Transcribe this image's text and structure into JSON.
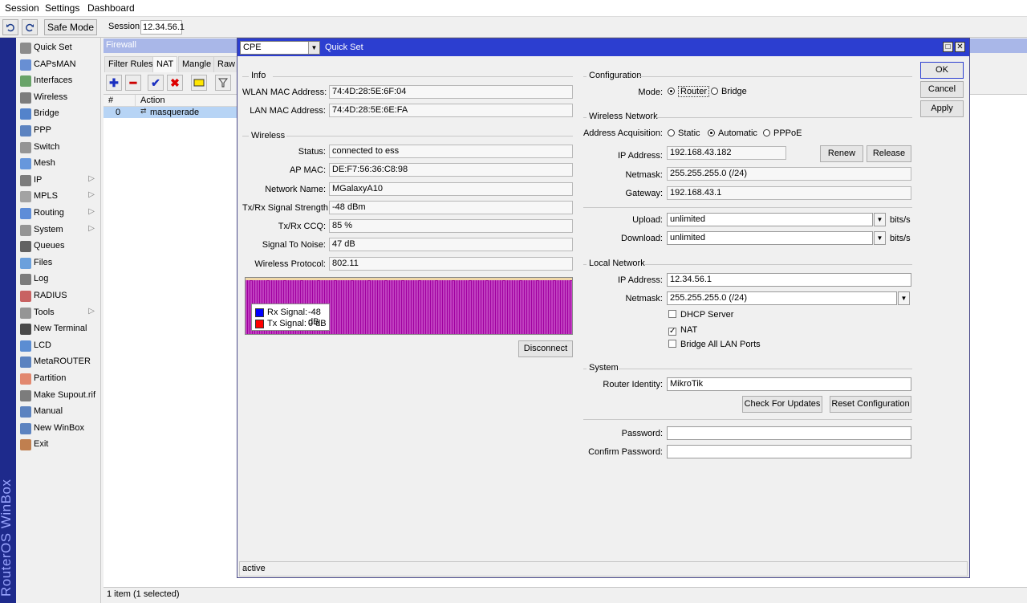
{
  "menubar": {
    "items": [
      "Session",
      "Settings",
      "Dashboard"
    ]
  },
  "toolbar": {
    "undo_icon": "undo-icon",
    "redo_icon": "redo-icon",
    "safe_mode": "Safe Mode",
    "session_label": "Session:",
    "session_value": "12.34.56.1"
  },
  "side_strip": {
    "text": "RouterOS WinBox"
  },
  "sidebar": {
    "items": [
      {
        "label": "Quick Set",
        "icon": "wand-icon",
        "arrow": ""
      },
      {
        "label": "CAPsMAN",
        "icon": "capsman-icon",
        "arrow": ""
      },
      {
        "label": "Interfaces",
        "icon": "interfaces-icon",
        "arrow": ""
      },
      {
        "label": "Wireless",
        "icon": "wireless-icon",
        "arrow": ""
      },
      {
        "label": "Bridge",
        "icon": "bridge-icon",
        "arrow": ""
      },
      {
        "label": "PPP",
        "icon": "ppp-icon",
        "arrow": ""
      },
      {
        "label": "Switch",
        "icon": "switch-icon",
        "arrow": ""
      },
      {
        "label": "Mesh",
        "icon": "mesh-icon",
        "arrow": ""
      },
      {
        "label": "IP",
        "icon": "ip-icon",
        "arrow": "▷"
      },
      {
        "label": "MPLS",
        "icon": "mpls-icon",
        "arrow": "▷"
      },
      {
        "label": "Routing",
        "icon": "routing-icon",
        "arrow": "▷"
      },
      {
        "label": "System",
        "icon": "gear-icon",
        "arrow": "▷"
      },
      {
        "label": "Queues",
        "icon": "queues-icon",
        "arrow": ""
      },
      {
        "label": "Files",
        "icon": "folder-icon",
        "arrow": ""
      },
      {
        "label": "Log",
        "icon": "log-icon",
        "arrow": ""
      },
      {
        "label": "RADIUS",
        "icon": "radius-icon",
        "arrow": ""
      },
      {
        "label": "Tools",
        "icon": "tools-icon",
        "arrow": "▷"
      },
      {
        "label": "New Terminal",
        "icon": "terminal-icon",
        "arrow": ""
      },
      {
        "label": "LCD",
        "icon": "lcd-icon",
        "arrow": ""
      },
      {
        "label": "MetaROUTER",
        "icon": "metarouter-icon",
        "arrow": ""
      },
      {
        "label": "Partition",
        "icon": "pie-icon",
        "arrow": ""
      },
      {
        "label": "Make Supout.rif",
        "icon": "supout-icon",
        "arrow": ""
      },
      {
        "label": "Manual",
        "icon": "help-icon",
        "arrow": ""
      },
      {
        "label": "New WinBox",
        "icon": "globe-icon",
        "arrow": ""
      },
      {
        "label": "Exit",
        "icon": "exit-icon",
        "arrow": ""
      }
    ]
  },
  "firewall": {
    "title": "Firewall",
    "tabs": [
      "Filter Rules",
      "NAT",
      "Mangle",
      "Raw"
    ],
    "selected_tab": "NAT",
    "tool_buttons": [
      "add-icon",
      "remove-icon",
      "enable-icon",
      "disable-icon",
      "comment-icon",
      "filter-icon"
    ],
    "columns": [
      "#",
      "Action"
    ],
    "rows": [
      {
        "num": "0",
        "action": "masquerade",
        "action_icon": "masquerade-icon"
      }
    ],
    "status": "1 item (1 selected)"
  },
  "quickset": {
    "mode_combo": "CPE",
    "title": "Quick Set",
    "buttons": {
      "ok": "OK",
      "cancel": "Cancel",
      "apply": "Apply"
    },
    "info": {
      "title": "Info",
      "wlan_mac_label": "WLAN MAC Address:",
      "wlan_mac": "74:4D:28:5E:6F:04",
      "lan_mac_label": "LAN MAC Address:",
      "lan_mac": "74:4D:28:5E:6E:FA"
    },
    "wireless": {
      "title": "Wireless",
      "fields": [
        {
          "label": "Status:",
          "value": "connected to ess"
        },
        {
          "label": "AP MAC:",
          "value": "DE:F7:56:36:C8:98"
        },
        {
          "label": "Network Name:",
          "value": "MGalaxyA10"
        },
        {
          "label": "Tx/Rx Signal Strength:",
          "value": "-48 dBm"
        },
        {
          "label": "Tx/Rx CCQ:",
          "value": "85 %"
        },
        {
          "label": "Signal To Noise:",
          "value": "47 dB"
        },
        {
          "label": "Wireless Protocol:",
          "value": "802.11"
        }
      ],
      "legend": [
        {
          "label": "Rx Signal:",
          "value": "-48 dB",
          "color": "#0000ff"
        },
        {
          "label": "Tx Signal:",
          "value": "0 dB",
          "color": "#ff0000"
        }
      ],
      "disconnect": "Disconnect"
    },
    "configuration": {
      "title": "Configuration",
      "mode_label": "Mode:",
      "modes": [
        "Router",
        "Bridge"
      ],
      "selected_mode": "Router"
    },
    "wireless_network": {
      "title": "Wireless Network",
      "acq_label": "Address Acquisition:",
      "acq_options": [
        "Static",
        "Automatic",
        "PPPoE"
      ],
      "selected_acq": "Automatic",
      "ip_label": "IP Address:",
      "ip": "192.168.43.182",
      "renew": "Renew",
      "release": "Release",
      "netmask_label": "Netmask:",
      "netmask": "255.255.255.0 (/24)",
      "gateway_label": "Gateway:",
      "gateway": "192.168.43.1",
      "upload_label": "Upload:",
      "upload": "unlimited",
      "download_label": "Download:",
      "download": "unlimited",
      "unit": "bits/s"
    },
    "local_network": {
      "title": "Local Network",
      "ip_label": "IP Address:",
      "ip": "12.34.56.1",
      "netmask_label": "Netmask:",
      "netmask": "255.255.255.0 (/24)",
      "dhcp_server": "DHCP Server",
      "dhcp_checked": false,
      "nat": "NAT",
      "nat_checked": true,
      "bridge_all": "Bridge All LAN Ports",
      "bridge_all_checked": false
    },
    "system": {
      "title": "System",
      "identity_label": "Router Identity:",
      "identity": "MikroTik",
      "check_updates": "Check For Updates",
      "reset_config": "Reset Configuration",
      "password_label": "Password:",
      "password": "",
      "confirm_label": "Confirm Password:",
      "confirm": ""
    },
    "status": "active"
  },
  "colors": {
    "titlebar": "#2c3ed0",
    "side_strip": "#1e2a8c",
    "chart_rx": "#0000ff",
    "chart_tx": "#ff0000",
    "chart_bars": "#a000a0"
  }
}
